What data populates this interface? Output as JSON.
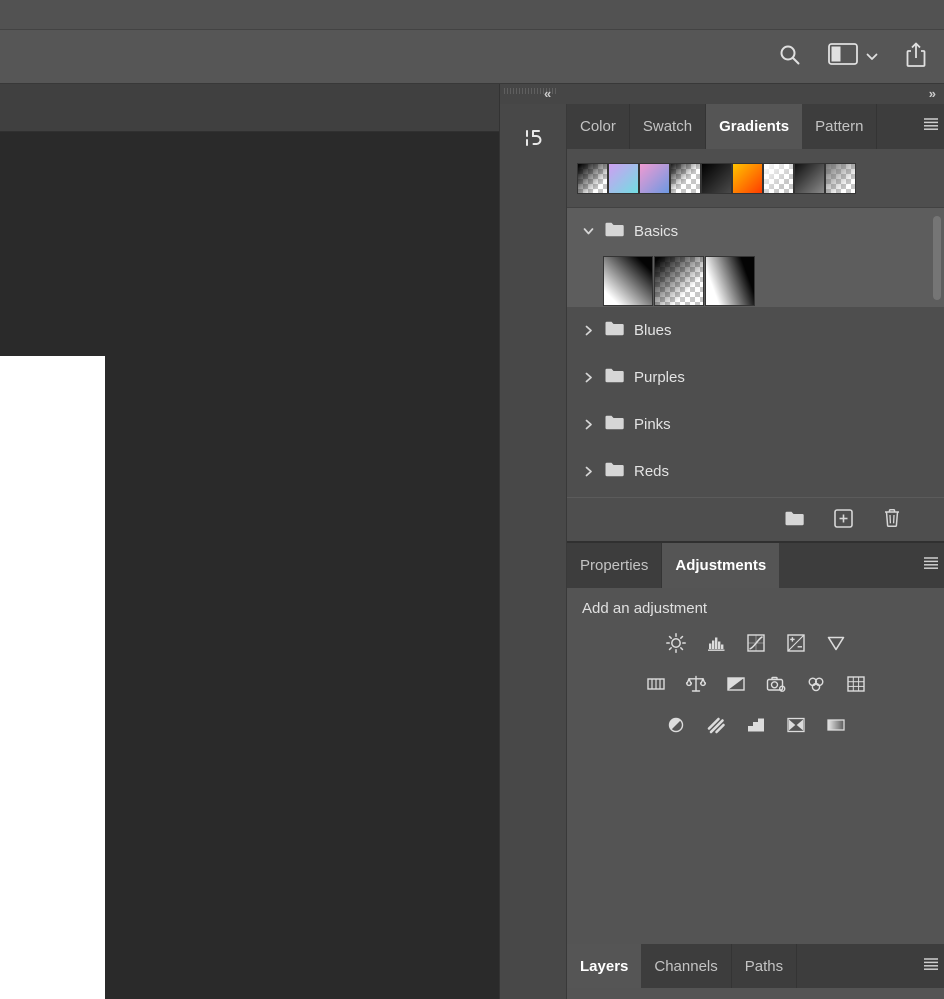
{
  "options_bar": {
    "icons": [
      "search-icon",
      "workspace-switcher-icon",
      "chevron-down-icon",
      "share-icon"
    ]
  },
  "dock": {
    "collapse_left": "«",
    "expand_right": "»",
    "collapsed_panel_icon": "collapsed-panel-icon"
  },
  "gradients_panel": {
    "tabs": [
      {
        "label": "Color",
        "active": false
      },
      {
        "label": "Swatch",
        "active": false
      },
      {
        "label": "Gradients",
        "active": true
      },
      {
        "label": "Pattern",
        "active": false
      }
    ],
    "presets": [
      {
        "name": "foreground-to-transparent",
        "bg": "linear-gradient(135deg,#060606 5%,rgba(0,0,0,0) 75%)"
      },
      {
        "name": "violet-to-cyan",
        "bg": "linear-gradient(135deg,#cf9ff2,#71dee2)"
      },
      {
        "name": "pink-to-blue",
        "bg": "linear-gradient(135deg,#f09ad2,#6d99e2)"
      },
      {
        "name": "black-to-transparent",
        "bg": "linear-gradient(135deg,rgba(0,0,0,0.9) 0%,rgba(0,0,0,0) 55%)"
      },
      {
        "name": "black-to-dark-gray",
        "bg": "linear-gradient(135deg,#000000,#4a4a4a)"
      },
      {
        "name": "orange-to-red",
        "bg": "linear-gradient(135deg,#ffc400,#ff3c00)"
      },
      {
        "name": "white-to-transparent",
        "bg": "linear-gradient(135deg,rgba(255,255,255,0.95),rgba(255,255,255,0) 70%)"
      },
      {
        "name": "black-to-gray",
        "bg": "linear-gradient(135deg,#101010,#8a8a8a)"
      },
      {
        "name": "gray-to-transparent",
        "bg": "linear-gradient(135deg,rgba(110,110,110,0.95),rgba(110,110,110,0) 75%)"
      }
    ],
    "groups": [
      {
        "name": "Basics",
        "expanded": true,
        "selected": true
      },
      {
        "name": "Blues",
        "expanded": false,
        "selected": false
      },
      {
        "name": "Purples",
        "expanded": false,
        "selected": false
      },
      {
        "name": "Pinks",
        "expanded": false,
        "selected": false
      },
      {
        "name": "Reds",
        "expanded": false,
        "selected": false
      }
    ],
    "basics_items": [
      {
        "name": "black-to-white",
        "bg": "linear-gradient(225deg,#040404 15%,#ffffff 85%)"
      },
      {
        "name": "black-to-transparent",
        "bg": "linear-gradient(135deg,#040404 5%,rgba(0,0,0,0) 70%)"
      },
      {
        "name": "white-to-black",
        "bg": "linear-gradient(250deg,#040404 20%,#ffffff 80%)"
      }
    ],
    "footer_icons": [
      "new-group-folder-icon",
      "new-gradient-icon",
      "delete-icon"
    ]
  },
  "adjustments_panel": {
    "tabs": [
      {
        "label": "Properties",
        "active": false
      },
      {
        "label": "Adjustments",
        "active": true
      }
    ],
    "heading": "Add an adjustment",
    "icon_rows": [
      [
        "brightness-contrast",
        "levels",
        "curves",
        "exposure",
        "vibrance"
      ],
      [
        "hue-saturation",
        "color-balance",
        "black-and-white",
        "photo-filter",
        "channel-mixer",
        "color-lookup"
      ],
      [
        "invert",
        "posterize",
        "threshold",
        "selective-color",
        "gradient-map"
      ]
    ]
  },
  "layers_panel": {
    "tabs": [
      {
        "label": "Layers",
        "active": true
      },
      {
        "label": "Channels",
        "active": false
      },
      {
        "label": "Paths",
        "active": false
      }
    ]
  },
  "colors": {
    "panel_bg": "#545454",
    "tabbar_bg": "#3d3d3d",
    "selected_row_bg": "#5d5d5d",
    "canvas_bg": "#2a2a2a",
    "icon_color": "#dcdcdc",
    "text_color": "#e0e0e0"
  }
}
